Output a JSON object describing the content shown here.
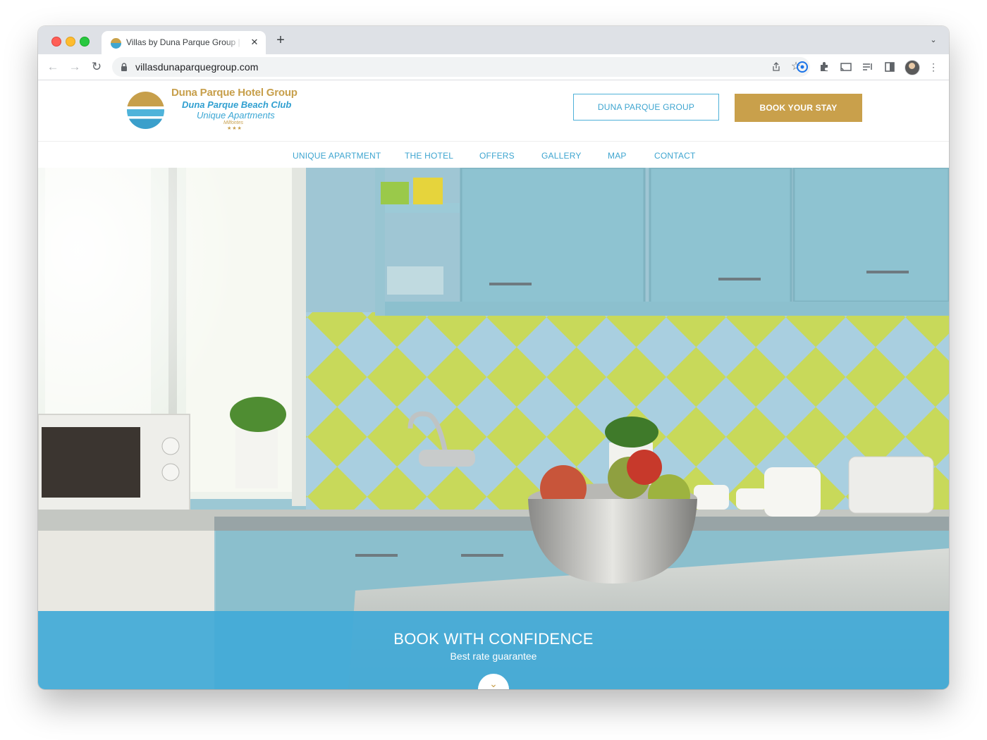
{
  "browser": {
    "tab_title": "Villas by Duna Parque Group | Official Site",
    "tab_close": "✕",
    "new_tab": "+",
    "tab_search": "⌄",
    "url": "villasdunaparquegroup.com"
  },
  "site": {
    "logo": {
      "group_name": "Duna Parque Hotel Group",
      "club_name": "Duna Parque Beach Club",
      "tagline": "Unique Apartments",
      "location": "Milfontes",
      "stars": "★★★"
    },
    "header_buttons": {
      "group": "DUNA PARQUE GROUP",
      "book": "BOOK YOUR STAY"
    },
    "nav": [
      "UNIQUE APARTMENT",
      "THE HOTEL",
      "OFFERS",
      "GALLERY",
      "MAP",
      "CONTACT"
    ]
  },
  "hero": {
    "banner_title": "BOOK WITH CONFIDENCE",
    "banner_subtitle": "Best rate guarantee",
    "scroll_icon": "⌄"
  },
  "colors": {
    "gold": "#c9a04b",
    "blue": "#3ea5d0",
    "banner": "#42aad7"
  }
}
